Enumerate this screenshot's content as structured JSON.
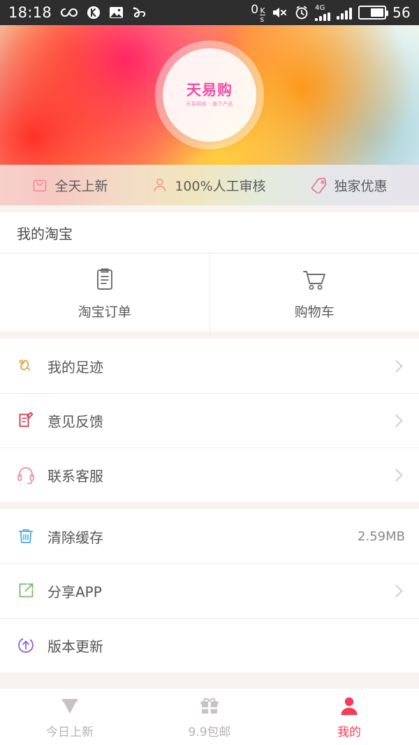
{
  "status_bar": {
    "time": "18:18",
    "icons_left": [
      "infinity-icon",
      "kuaishou-icon",
      "photo-icon",
      "ribbon-icon"
    ],
    "net_speed": "0",
    "net_speed_unit_top": "K",
    "net_speed_unit_bottom": "s",
    "icons_right": [
      "mute-icon",
      "alarm-icon",
      "signal-4g-icon",
      "signal-icon",
      "battery-icon"
    ],
    "network_type": "4G",
    "battery_level": "56"
  },
  "banner": {
    "logo_main": "天易购",
    "logo_sub": "天易网络 - 旗下产品"
  },
  "features": [
    {
      "icon": "bag-icon",
      "label": "全天上新",
      "color": "#ef8b96"
    },
    {
      "icon": "person-icon",
      "label": "100%人工审核",
      "color": "#ef9a86"
    },
    {
      "icon": "tag-icon",
      "label": "独家优惠",
      "color": "#ed6f94"
    }
  ],
  "my_taobao": {
    "title": "我的淘宝",
    "tiles": [
      {
        "icon": "order-clipboard-icon",
        "label": "淘宝订单"
      },
      {
        "icon": "shopping-cart-icon",
        "label": "购物车"
      }
    ]
  },
  "list_group_1": [
    {
      "icon": "footprint-icon",
      "label": "我的足迹",
      "color": "#e89b35",
      "value": "",
      "chevron": true
    },
    {
      "icon": "feedback-icon",
      "label": "意见反馈",
      "color": "#cc3a4e",
      "value": "",
      "chevron": true
    },
    {
      "icon": "headset-icon",
      "label": "联系客服",
      "color": "#ef8aa0",
      "value": "",
      "chevron": true
    }
  ],
  "list_group_2": [
    {
      "icon": "trash-icon",
      "label": "清除缓存",
      "color": "#4fa8e0",
      "value": "2.59MB",
      "chevron": false
    },
    {
      "icon": "share-icon",
      "label": "分享APP",
      "color": "#7cb86a",
      "value": "",
      "chevron": true
    },
    {
      "icon": "update-icon",
      "label": "版本更新",
      "color": "#8b62d8",
      "value": "",
      "chevron": false
    }
  ],
  "tabbar": {
    "items": [
      {
        "icon": "diamond-icon",
        "label": "今日上新",
        "active": false
      },
      {
        "icon": "gift-icon",
        "label": "9.9包邮",
        "active": false
      },
      {
        "icon": "user-icon",
        "label": "我的",
        "active": true
      }
    ],
    "active_color": "#fb3b55",
    "inactive_color": "#c8c2c2"
  }
}
